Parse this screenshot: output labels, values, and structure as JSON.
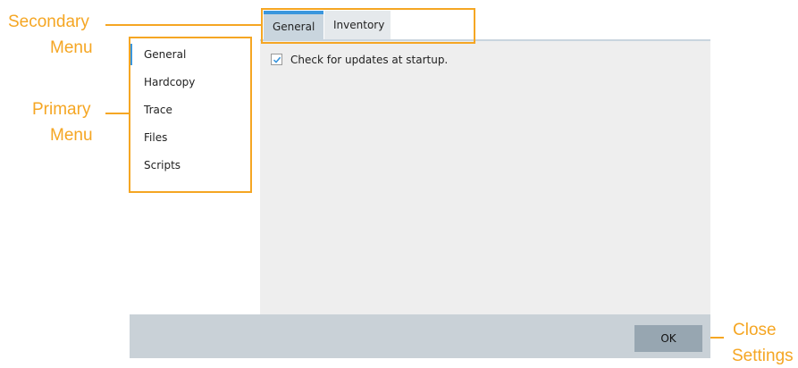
{
  "callouts": {
    "secondary_line1": "Secondary",
    "secondary_line2": "Menu",
    "primary_line1": "Primary",
    "primary_line2": "Menu",
    "close_line1": "Close",
    "close_line2": "Settings"
  },
  "tabs": [
    {
      "label": "General",
      "active": true
    },
    {
      "label": "Inventory",
      "active": false
    }
  ],
  "primary_menu": [
    {
      "label": "General",
      "active": true
    },
    {
      "label": "Hardcopy",
      "active": false
    },
    {
      "label": "Trace",
      "active": false
    },
    {
      "label": "Files",
      "active": false
    },
    {
      "label": "Scripts",
      "active": false
    }
  ],
  "content": {
    "update_checkbox_label": "Check for updates at startup.",
    "update_checkbox_checked": true
  },
  "footer": {
    "ok_label": "OK"
  },
  "colors": {
    "annotation": "#f5a623",
    "accent": "#3a96dd"
  },
  "icons": {
    "checkmark": "check-icon"
  }
}
